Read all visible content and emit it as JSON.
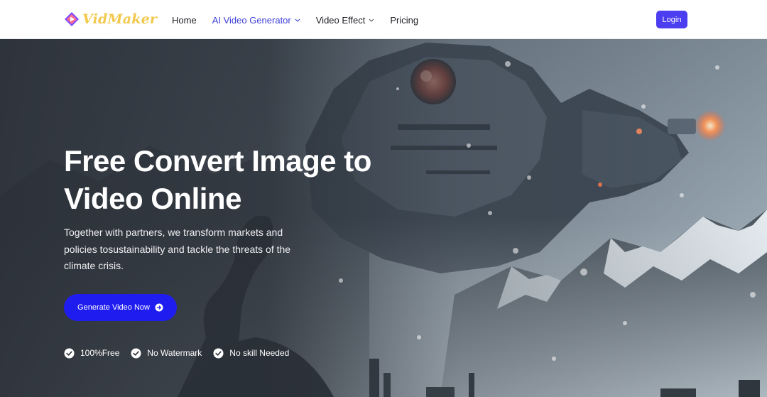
{
  "brand": {
    "name": "VidMaker",
    "logo_icon": "play-diamond-icon"
  },
  "nav": {
    "items": [
      {
        "label": "Home",
        "active": false,
        "has_dropdown": false
      },
      {
        "label": "AI Video Generator",
        "active": true,
        "has_dropdown": true
      },
      {
        "label": "Video Effect",
        "active": false,
        "has_dropdown": true
      },
      {
        "label": "Pricing",
        "active": false,
        "has_dropdown": false
      }
    ]
  },
  "header": {
    "login_label": "Login"
  },
  "hero": {
    "title_line1": "Free Convert Image to",
    "title_line2": "Video Online",
    "subtitle_line1": "Together with partners, we transform markets and",
    "subtitle_line2": "policies tosustainability and tackle the threats of the",
    "subtitle_line3": "climate crisis.",
    "cta_label": "Generate Video Now",
    "cta_icon": "arrow-circle-right-icon",
    "features": [
      {
        "label": "100%Free",
        "icon": "check-circle-icon"
      },
      {
        "label": "No Watermark",
        "icon": "check-circle-icon"
      },
      {
        "label": "No skill Needed",
        "icon": "check-circle-icon"
      }
    ]
  },
  "colors": {
    "accent": "#3b3fd8",
    "login_bg": "#4b3df0",
    "cta_bg": "#1f1cf0",
    "logo_yellow": "#f2c94c"
  }
}
